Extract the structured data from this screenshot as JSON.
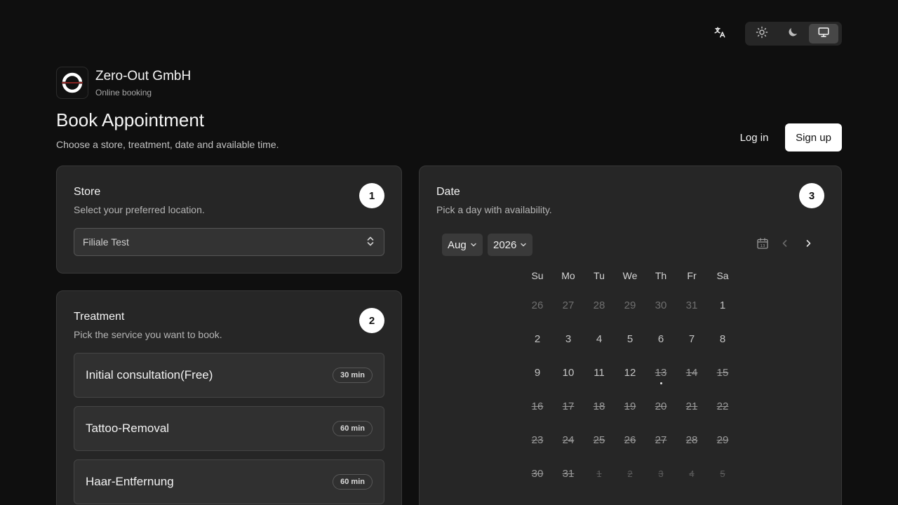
{
  "brand": {
    "name": "Zero-Out GmbH",
    "subtitle": "Online booking"
  },
  "page": {
    "title": "Book Appointment",
    "subtitle": "Choose a store, treatment, date and available time."
  },
  "auth": {
    "login_label": "Log in",
    "signup_label": "Sign up"
  },
  "theme": {
    "options": [
      "sun-icon",
      "moon-icon",
      "monitor-icon"
    ],
    "selected": "monitor-icon"
  },
  "store_card": {
    "title": "Store",
    "description": "Select your preferred location.",
    "step": "1",
    "selected_store": "Filiale Test"
  },
  "treatment_card": {
    "title": "Treatment",
    "description": "Pick the service you want to book.",
    "step": "2",
    "treatments": [
      {
        "name": "Initial consultation(Free)",
        "duration": "30 min"
      },
      {
        "name": "Tattoo-Removal",
        "duration": "60 min"
      },
      {
        "name": "Haar-Entfernung",
        "duration": "60 min"
      }
    ]
  },
  "date_card": {
    "title": "Date",
    "description": "Pick a day with availability.",
    "step": "3",
    "month": "Aug",
    "year": "2026",
    "weekdays": [
      "Su",
      "Mo",
      "Tu",
      "We",
      "Th",
      "Fr",
      "Sa"
    ],
    "weeks": [
      [
        "26",
        "27",
        "28",
        "29",
        "30",
        "31",
        "1"
      ],
      [
        "2",
        "3",
        "4",
        "5",
        "6",
        "7",
        "8"
      ],
      [
        "9",
        "10",
        "11",
        "12",
        "13",
        "14",
        "15"
      ],
      [
        "16",
        "17",
        "18",
        "19",
        "20",
        "21",
        "22"
      ],
      [
        "23",
        "24",
        "25",
        "26",
        "27",
        "28",
        "29"
      ],
      [
        "30",
        "31",
        "1",
        "2",
        "3",
        "4",
        "5"
      ]
    ],
    "today": "13"
  },
  "colors": {
    "background": "#0f0f0f",
    "card": "#262626",
    "accent": "#ffffff",
    "logo_ring": "#ffffff",
    "logo_line": "#d0312d"
  }
}
